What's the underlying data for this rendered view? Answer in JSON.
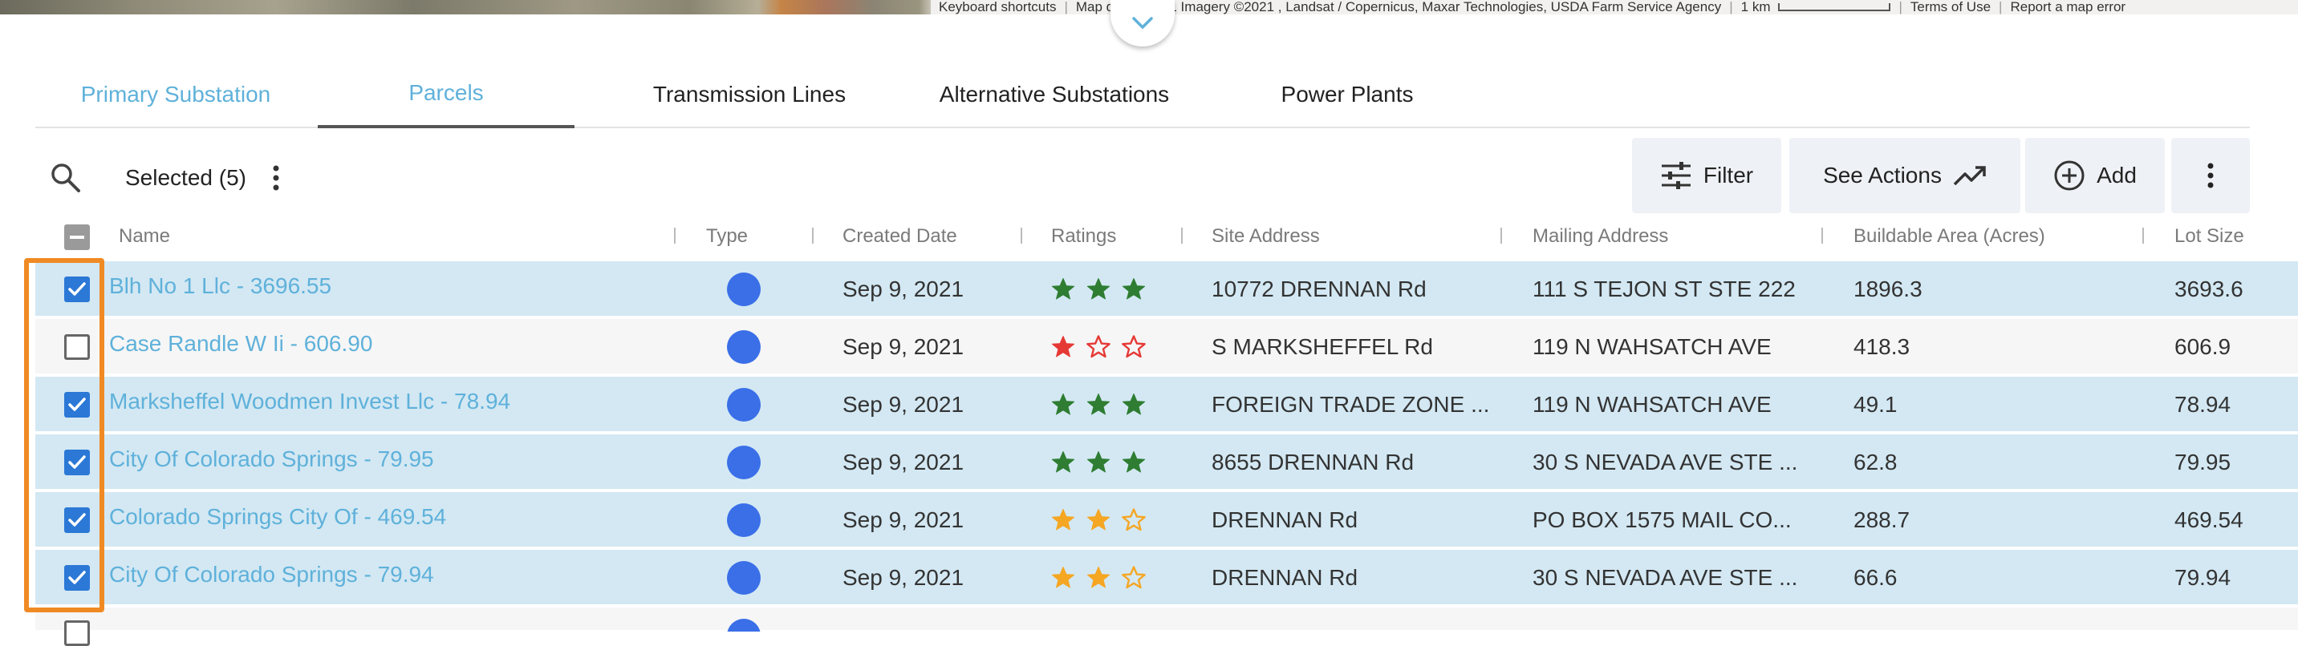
{
  "map": {
    "attribution": {
      "keyboard_shortcuts": "Keyboard shortcuts",
      "map_data": "Map data ©2021 Imagery ©2021 , Landsat / Copernicus, Maxar Technologies, USDA Farm Service Agency",
      "scale_label": "1 km",
      "terms": "Terms of Use",
      "report": "Report a map error"
    }
  },
  "tabs": [
    {
      "label": "Primary Substation"
    },
    {
      "label": "Parcels"
    },
    {
      "label": "Transmission Lines"
    },
    {
      "label": "Alternative Substations"
    },
    {
      "label": "Power Plants"
    }
  ],
  "toolbar": {
    "selected_label": "Selected (5)",
    "filter_label": "Filter",
    "see_actions_label": "See Actions",
    "add_label": "Add"
  },
  "table": {
    "columns": [
      "Name",
      "Type",
      "Created Date",
      "Ratings",
      "Site Address",
      "Mailing Address",
      "Buildable Area (Acres)",
      "Lot Size"
    ],
    "rows": [
      {
        "checked": true,
        "name": "Blh No 1 Llc - 3696.55",
        "created": "Sep 9, 2021",
        "rating": 3,
        "rating_color": "#2e7d32",
        "site": "10772 DRENNAN Rd",
        "mailing": "111 S TEJON ST STE 222",
        "buildable": "1896.3",
        "lot": "3693.6"
      },
      {
        "checked": false,
        "name": "Case Randle W Ii - 606.90",
        "created": "Sep 9, 2021",
        "rating": 1,
        "rating_color": "#e53935",
        "site": "S MARKSHEFFEL Rd",
        "mailing": "119 N WAHSATCH AVE",
        "buildable": "418.3",
        "lot": "606.9"
      },
      {
        "checked": true,
        "name": "Marksheffel Woodmen Invest Llc - 78.94",
        "created": "Sep 9, 2021",
        "rating": 3,
        "rating_color": "#2e7d32",
        "site": "FOREIGN TRADE ZONE ...",
        "mailing": "119 N WAHSATCH AVE",
        "buildable": "49.1",
        "lot": "78.94"
      },
      {
        "checked": true,
        "name": "City Of Colorado Springs - 79.95",
        "created": "Sep 9, 2021",
        "rating": 3,
        "rating_color": "#2e7d32",
        "site": "8655 DRENNAN Rd",
        "mailing": "30 S NEVADA AVE STE ...",
        "buildable": "62.8",
        "lot": "79.95"
      },
      {
        "checked": true,
        "name": "Colorado Springs City Of - 469.54",
        "created": "Sep 9, 2021",
        "rating": 2,
        "rating_color": "#f5a623",
        "site": "DRENNAN Rd",
        "mailing": "PO BOX 1575 MAIL CO...",
        "buildable": "288.7",
        "lot": "469.54"
      },
      {
        "checked": true,
        "name": "City Of Colorado Springs - 79.94",
        "created": "Sep 9, 2021",
        "rating": 2,
        "rating_color": "#f5a623",
        "site": "DRENNAN Rd",
        "mailing": "30 S NEVADA AVE STE ...",
        "buildable": "66.6",
        "lot": "79.94"
      }
    ]
  },
  "colors": {
    "accent": "#5fb1da",
    "row_selected": "#d3e8f3",
    "checkbox_blue": "#2b78d6",
    "type_dot": "#3a6fe8",
    "highlight": "#f08a24"
  }
}
